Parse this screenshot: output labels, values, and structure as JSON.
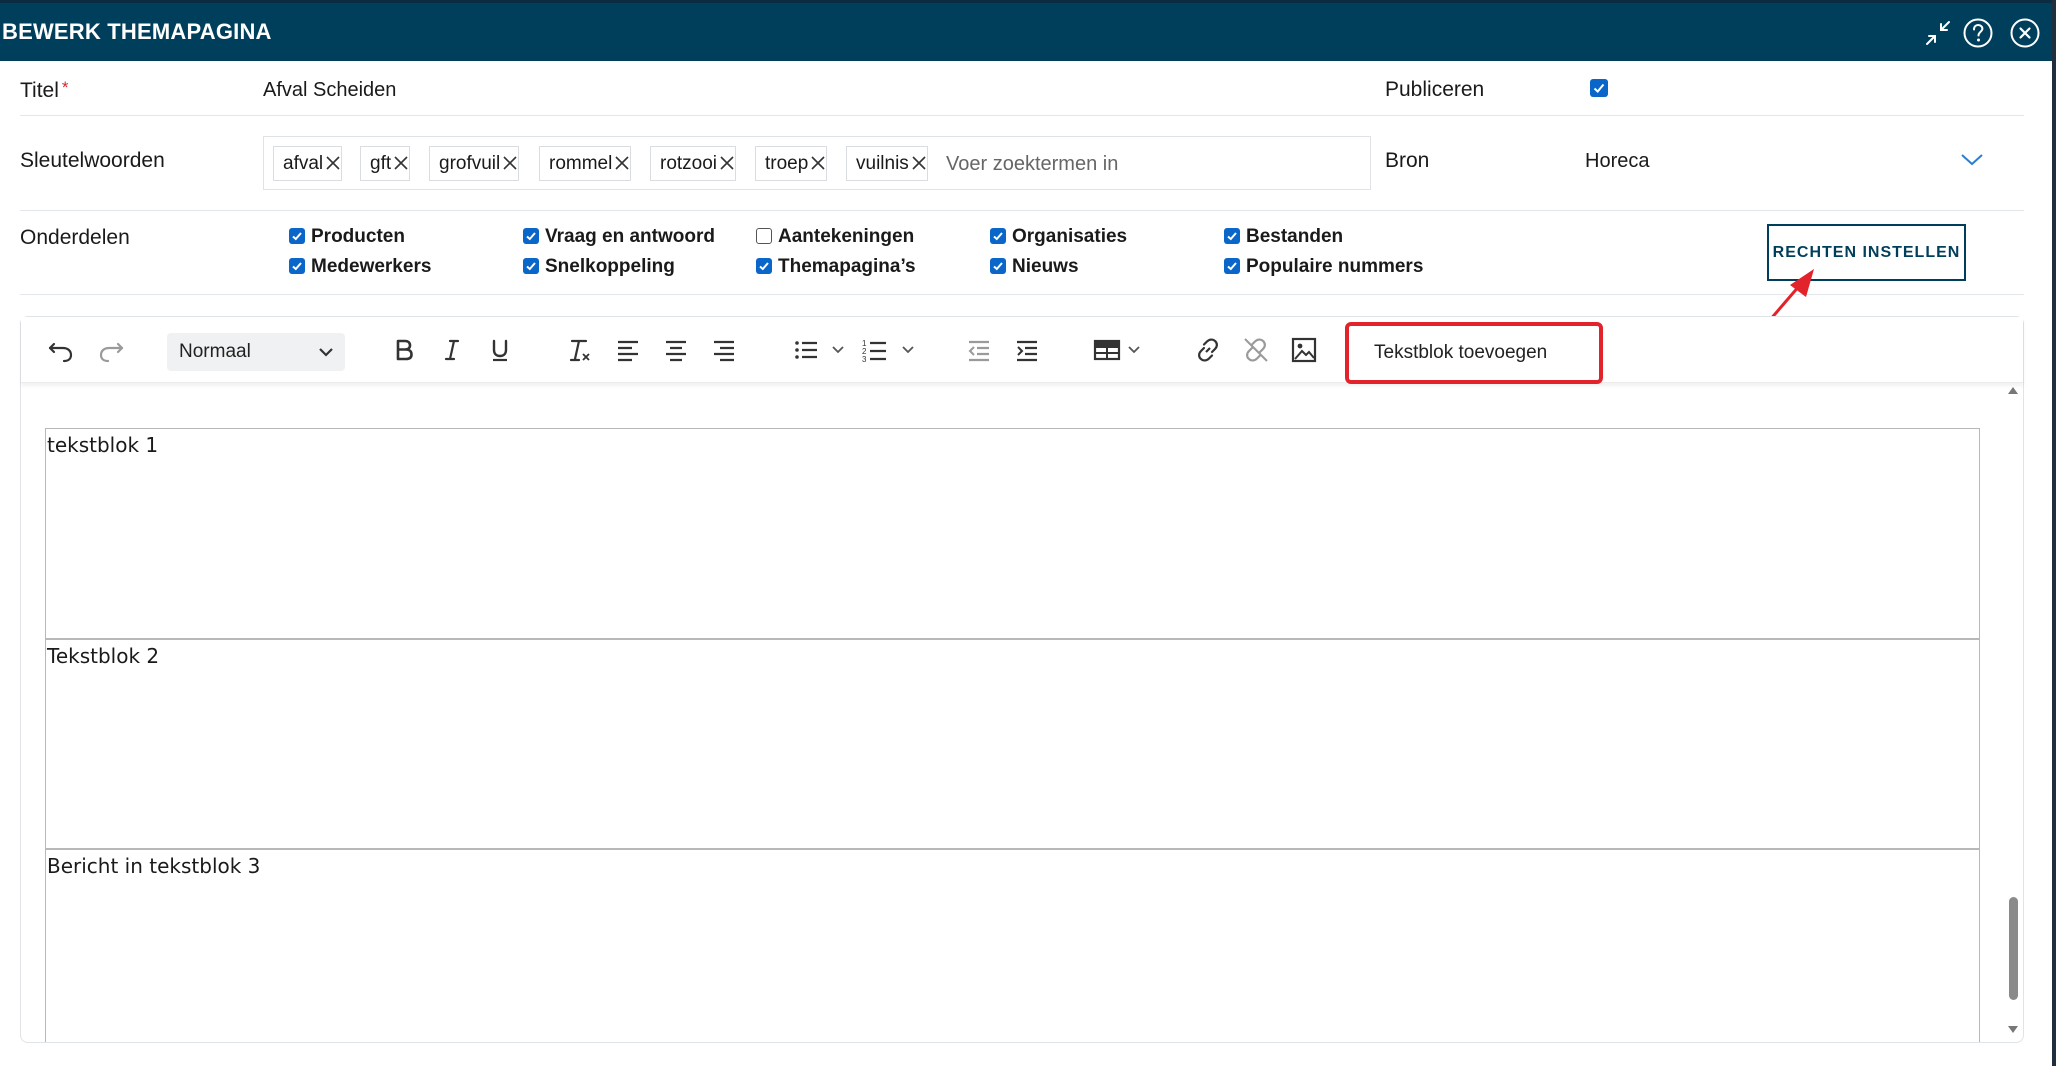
{
  "window": {
    "title": "BEWERK THEMAPAGINA",
    "controls": [
      "minimize-icon",
      "help-icon",
      "close-icon"
    ]
  },
  "form": {
    "titel_label": "Titel",
    "required_mark": "*",
    "titel_value": "Afval Scheiden",
    "publiceren_label": "Publiceren",
    "publiceren_checked": true,
    "sleutelwoorden_label": "Sleutelwoorden",
    "keywords": [
      "afval",
      "gft",
      "grofvuil",
      "rommel",
      "rotzooi",
      "troep",
      "vuilnis"
    ],
    "keyword_placeholder": "Voer zoektermen in",
    "bron_label": "Bron",
    "bron_value": "Horeca",
    "onderdelen_label": "Onderdelen",
    "onderdelen": [
      {
        "label": "Producten",
        "checked": true
      },
      {
        "label": "Medewerkers",
        "checked": true
      },
      {
        "label": "Vraag en antwoord",
        "checked": true
      },
      {
        "label": "Snelkoppeling",
        "checked": true
      },
      {
        "label": "Aantekeningen",
        "checked": false
      },
      {
        "label": "Themapagina’s",
        "checked": true
      },
      {
        "label": "Organisaties",
        "checked": true
      },
      {
        "label": "Nieuws",
        "checked": true
      },
      {
        "label": "Bestanden",
        "checked": true
      },
      {
        "label": "Populaire nummers",
        "checked": true
      }
    ],
    "rechten_button": "RECHTEN INSTELLEN"
  },
  "toolbar": {
    "format_value": "Normaal",
    "tekstblok_button": "Tekstblok toevoegen",
    "icons": [
      "undo-icon",
      "redo-icon",
      "bold-icon",
      "italic-icon",
      "underline-icon",
      "clear-format-icon",
      "align-left-icon",
      "align-center-icon",
      "align-right-icon",
      "bullet-list-icon",
      "numbered-list-icon",
      "outdent-icon",
      "indent-icon",
      "table-icon",
      "link-icon",
      "unlink-icon",
      "image-icon"
    ]
  },
  "editor": {
    "blocks": [
      "tekstblok 1",
      "Tekstblok 2",
      "Bericht in tekstblok 3"
    ]
  },
  "colors": {
    "header": "#003f5c",
    "checkbox": "#0a66c8",
    "highlight": "#e3232b",
    "annotation_arrow": "#e3232b"
  }
}
